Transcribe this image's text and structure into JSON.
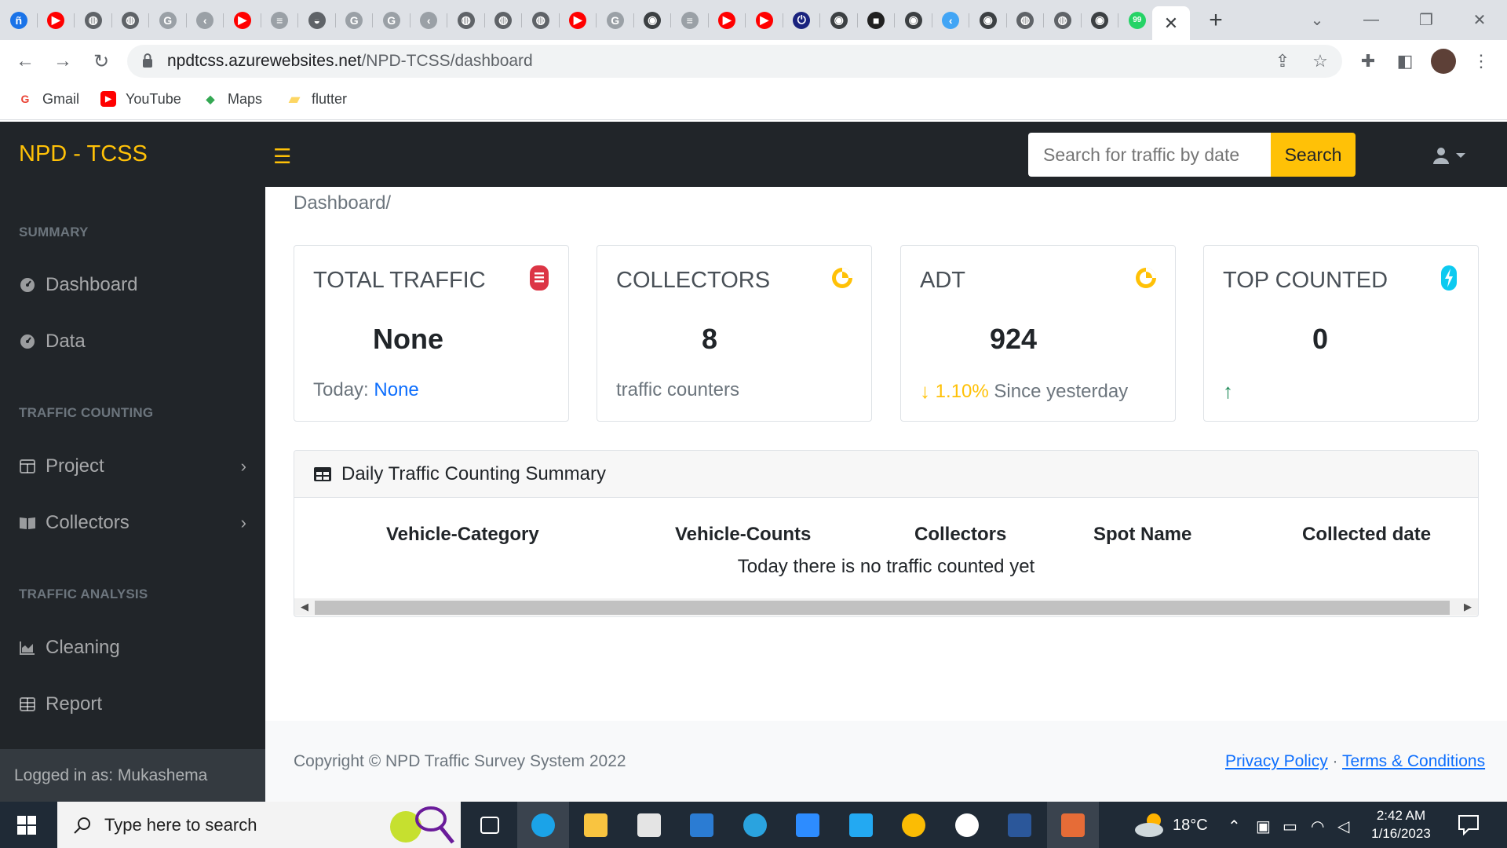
{
  "browser": {
    "tab_icons": [
      {
        "name": "favicon-app",
        "color": "#1a73e8",
        "glyph": "ñ"
      },
      {
        "name": "youtube-icon",
        "color": "#ff0000",
        "glyph": "▶"
      },
      {
        "name": "globe-icon",
        "color": "#5f6368",
        "glyph": "◍"
      },
      {
        "name": "globe-icon",
        "color": "#5f6368",
        "glyph": "◍"
      },
      {
        "name": "google-icon",
        "color": "#9aa0a6",
        "glyph": "G"
      },
      {
        "name": "flutter-icon",
        "color": "#9aa0a6",
        "glyph": "‹"
      },
      {
        "name": "youtube-icon",
        "color": "#ff0000",
        "glyph": "▶"
      },
      {
        "name": "stackoverflow-icon",
        "color": "#9aa0a6",
        "glyph": "≡"
      },
      {
        "name": "cloud-icon",
        "color": "#5f6368",
        "glyph": "◒"
      },
      {
        "name": "google-icon",
        "color": "#9aa0a6",
        "glyph": "G"
      },
      {
        "name": "google-icon",
        "color": "#9aa0a6",
        "glyph": "G"
      },
      {
        "name": "flutter-icon",
        "color": "#9aa0a6",
        "glyph": "‹"
      },
      {
        "name": "globe-icon",
        "color": "#5f6368",
        "glyph": "◍"
      },
      {
        "name": "globe-icon",
        "color": "#5f6368",
        "glyph": "◍"
      },
      {
        "name": "globe-icon",
        "color": "#5f6368",
        "glyph": "◍"
      },
      {
        "name": "youtube-icon",
        "color": "#ff0000",
        "glyph": "▶"
      },
      {
        "name": "google-icon",
        "color": "#9aa0a6",
        "glyph": "G"
      },
      {
        "name": "github-icon",
        "color": "#3c4043",
        "glyph": "◉"
      },
      {
        "name": "stackoverflow-icon",
        "color": "#9aa0a6",
        "glyph": "≡"
      },
      {
        "name": "youtube-icon",
        "color": "#ff0000",
        "glyph": "▶"
      },
      {
        "name": "youtube-icon",
        "color": "#ff0000",
        "glyph": "▶"
      },
      {
        "name": "power-icon",
        "color": "#1a237e",
        "glyph": "⏻"
      },
      {
        "name": "github-icon",
        "color": "#3c4043",
        "glyph": "◉"
      },
      {
        "name": "terminal-icon",
        "color": "#212121",
        "glyph": "■"
      },
      {
        "name": "github-icon",
        "color": "#3c4043",
        "glyph": "◉"
      },
      {
        "name": "flutter-icon",
        "color": "#42a5f5",
        "glyph": "‹"
      },
      {
        "name": "github-icon",
        "color": "#3c4043",
        "glyph": "◉"
      },
      {
        "name": "globe-icon",
        "color": "#5f6368",
        "glyph": "◍"
      },
      {
        "name": "globe-icon",
        "color": "#5f6368",
        "glyph": "◍"
      },
      {
        "name": "github-icon",
        "color": "#3c4043",
        "glyph": "◉"
      },
      {
        "name": "whatsapp-icon",
        "color": "#25d366",
        "glyph": "99"
      }
    ],
    "active_tab_close": "✕",
    "new_tab": "+",
    "url_host": "npdtcss.azurewebsites.net",
    "url_path": "/NPD-TCSS/dashboard",
    "bookmarks": [
      {
        "label": "Gmail",
        "icon": "G",
        "color": "#ea4335"
      },
      {
        "label": "YouTube",
        "icon": "▶",
        "color": "#ff0000"
      },
      {
        "label": "Maps",
        "icon": "◆",
        "color": "#34a853"
      },
      {
        "label": "flutter",
        "icon": "▰",
        "color": "#fdd663"
      }
    ]
  },
  "app": {
    "brand": "NPD - TCSS",
    "search_placeholder": "Search for traffic by date",
    "search_button": "Search",
    "colors": {
      "accent": "#ffc107",
      "dark": "#212529",
      "link": "#0d6efd",
      "danger": "#dc3545",
      "success": "#198754",
      "info": "#0dcaf0"
    }
  },
  "sidebar": {
    "sections": [
      {
        "heading": "SUMMARY",
        "items": [
          {
            "label": "Dashboard",
            "icon": "dashboard-icon"
          },
          {
            "label": "Data",
            "icon": "dashboard-icon"
          }
        ]
      },
      {
        "heading": "TRAFFIC COUNTING",
        "items": [
          {
            "label": "Project",
            "icon": "columns-icon",
            "expandable": true
          },
          {
            "label": "Collectors",
            "icon": "book-icon",
            "expandable": true
          }
        ]
      },
      {
        "heading": "TRAFFIC ANALYSIS",
        "items": [
          {
            "label": "Cleaning",
            "icon": "area-chart-icon"
          },
          {
            "label": "Report",
            "icon": "table-icon"
          }
        ]
      }
    ],
    "footer": "Logged in as: Mukashema"
  },
  "main": {
    "breadcrumb": "Dashboard/",
    "cards": [
      {
        "title": "TOTAL TRAFFIC",
        "value": "None",
        "foot_label": "Today:",
        "foot_value": "None",
        "icon": "file-icon",
        "icon_color": "#dc3545"
      },
      {
        "title": "COLLECTORS",
        "value": "8",
        "foot_label": "traffic counters",
        "foot_value": "",
        "icon": "pie-chart-icon",
        "icon_color": "#ffc107"
      },
      {
        "title": "ADT",
        "value": "924",
        "foot_arrow": "↓",
        "foot_value": "1.10%",
        "foot_label": "Since yesterday",
        "icon": "pie-chart-icon",
        "icon_color": "#ffc107"
      },
      {
        "title": "TOP COUNTED",
        "value": "0",
        "foot_arrow": "↑",
        "foot_value": "",
        "foot_label": "",
        "icon": "bolt-icon",
        "icon_color": "#0dcaf0"
      }
    ],
    "summary": {
      "title": "Daily Traffic Counting Summary",
      "columns": [
        "Vehicle-Category",
        "Vehicle-Counts",
        "Collectors",
        "Spot Name",
        "Collected date"
      ],
      "empty_message": "Today there is no traffic counted yet"
    },
    "footer": {
      "copyright": "Copyright © NPD Traffic Survey System 2022",
      "privacy": "Privacy Policy",
      "separator": "·",
      "terms": "Terms & Conditions"
    }
  },
  "taskbar": {
    "search_placeholder": "Type here to search",
    "apps": [
      {
        "name": "task-view-icon",
        "color": "#ffffff"
      },
      {
        "name": "edge-icon",
        "color": "#1ba3e8",
        "active": true
      },
      {
        "name": "file-explorer-icon",
        "color": "#f9c440"
      },
      {
        "name": "store-icon",
        "color": "#e4e4e4"
      },
      {
        "name": "mail-icon",
        "color": "#2b7cd3"
      },
      {
        "name": "telegram-icon",
        "color": "#2aa3df"
      },
      {
        "name": "zoom-icon",
        "color": "#2d8cff"
      },
      {
        "name": "vscode-icon",
        "color": "#23a9f2"
      },
      {
        "name": "chrome-icon",
        "color": "#fbbc04"
      },
      {
        "name": "settings-icon",
        "color": "#ffffff"
      },
      {
        "name": "word-icon",
        "color": "#2b579a"
      },
      {
        "name": "paint-icon",
        "color": "#e66c37",
        "active": true
      }
    ],
    "temperature": "18°C",
    "time": "2:42 AM",
    "date": "1/16/2023"
  }
}
